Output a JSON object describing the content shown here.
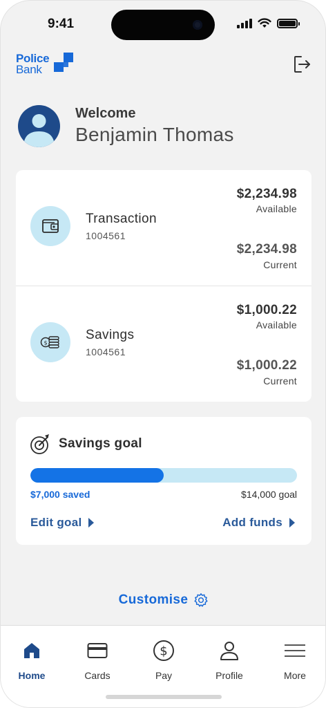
{
  "status_bar": {
    "time": "9:41"
  },
  "header": {
    "logo_line1": "Police",
    "logo_line2": "Bank",
    "brand_color": "#1769d8",
    "logout_icon": "logout-icon"
  },
  "welcome": {
    "label": "Welcome",
    "name": "Benjamin Thomas"
  },
  "accounts": [
    {
      "name": "Transaction",
      "number": "1004561",
      "icon": "wallet-icon",
      "available_amount": "$2,234.98",
      "available_label": "Available",
      "current_amount": "$2,234.98",
      "current_label": "Current"
    },
    {
      "name": "Savings",
      "number": "1004561",
      "icon": "coins-icon",
      "available_amount": "$1,000.22",
      "available_label": "Available",
      "current_amount": "$1,000.22",
      "current_label": "Current"
    }
  ],
  "savings_goal": {
    "title": "Savings goal",
    "icon": "target-icon",
    "saved_text": "$7,000 saved",
    "goal_text": "$14,000 goal",
    "progress_fraction": 0.5,
    "edit_label": "Edit goal",
    "add_label": "Add funds"
  },
  "customise": {
    "label": "Customise",
    "icon": "gear-icon"
  },
  "tab_bar": {
    "items": [
      {
        "label": "Home",
        "icon": "home-icon",
        "active": true
      },
      {
        "label": "Cards",
        "icon": "card-icon",
        "active": false
      },
      {
        "label": "Pay",
        "icon": "dollar-icon",
        "active": false
      },
      {
        "label": "Profile",
        "icon": "person-icon",
        "active": false
      },
      {
        "label": "More",
        "icon": "menu-icon",
        "active": false
      }
    ]
  },
  "colors": {
    "accent": "#1769d8",
    "progress_fill": "#1473e6",
    "progress_track": "#c6e8f5",
    "avatar_bg": "#1e4a8a",
    "link": "#2a5a9a"
  }
}
